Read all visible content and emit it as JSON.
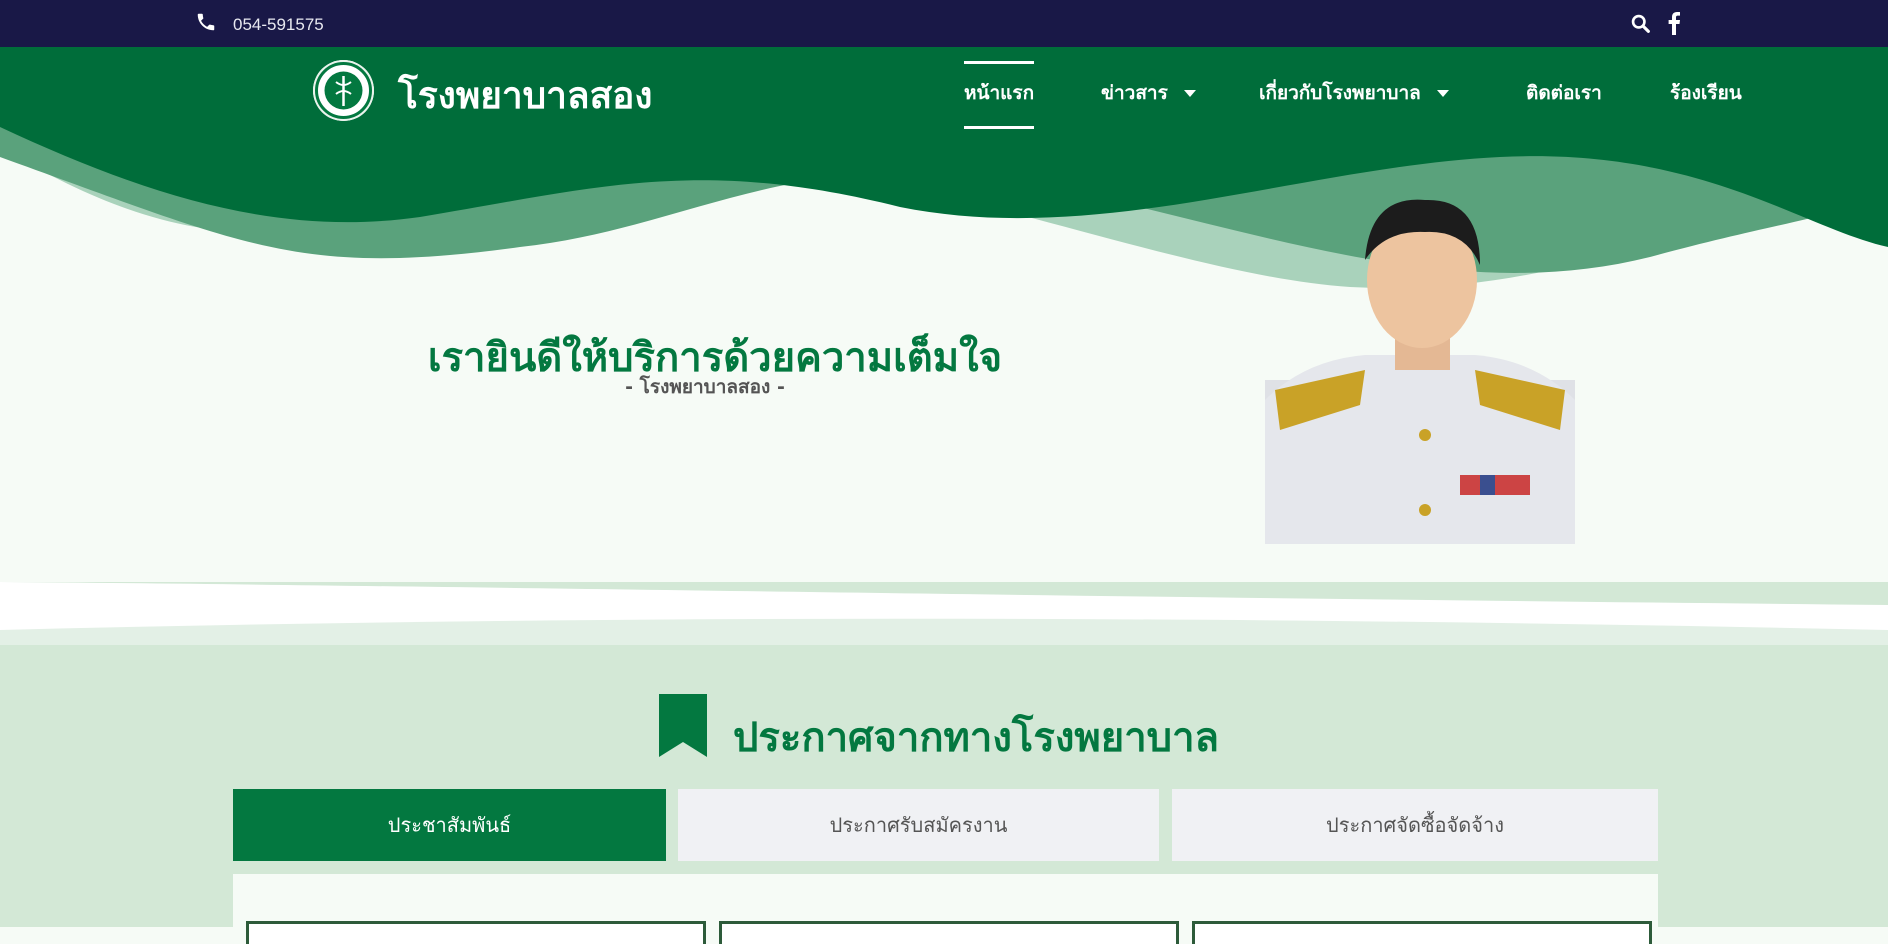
{
  "topbar": {
    "phone": "054-591575",
    "icons": [
      "phone-icon",
      "search-icon",
      "facebook-icon"
    ]
  },
  "header": {
    "site_title": "โรงพยาบาลสอง",
    "nav": [
      {
        "label": "หน้าแรก",
        "active": true
      },
      {
        "label": "ข่าวสาร",
        "has_dropdown": true
      },
      {
        "label": "เกี่ยวกับโรงพยาบาล",
        "has_dropdown": true
      },
      {
        "label": "ติดต่อเรา"
      },
      {
        "label": "ร้องเรียน"
      }
    ]
  },
  "hero": {
    "title": "เรายินดีให้บริการด้วยความเต็มใจ",
    "subtitle": "- โรงพยาบาลสอง -"
  },
  "announcements": {
    "title": "ประกาศจากทางโรงพยาบาล",
    "tabs": [
      {
        "label": "ประชาสัมพันธ์",
        "active": true
      },
      {
        "label": "ประกาศรับสมัครงาน"
      },
      {
        "label": "ประกาศจัดซื้อจัดจ้าง"
      }
    ]
  },
  "colors": {
    "topbar": "#191847",
    "brand_green": "#037840",
    "light_green": "#d3e8d6",
    "tab_inactive": "#f0f1f4"
  }
}
